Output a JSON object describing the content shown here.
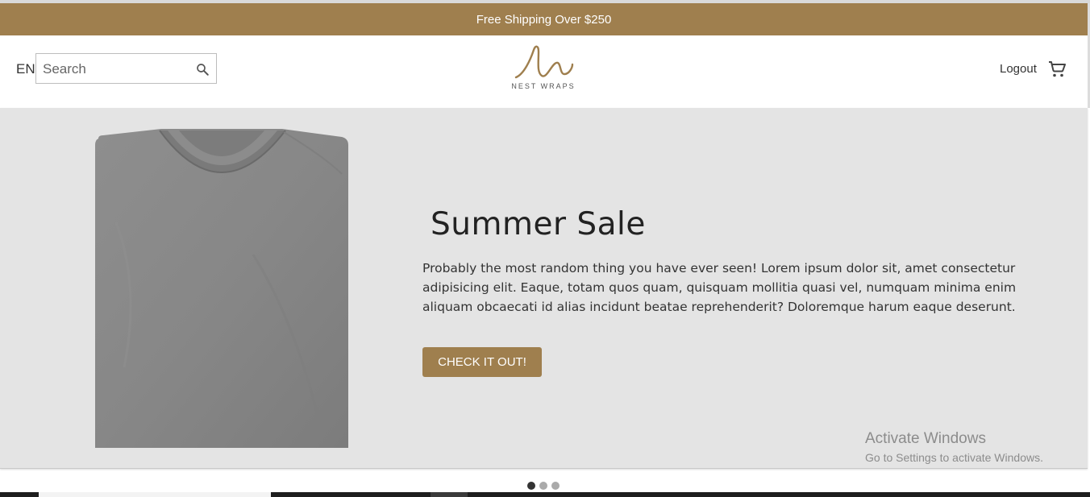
{
  "announcement": {
    "text": "Free Shipping Over $250"
  },
  "header": {
    "language": "EN",
    "search": {
      "placeholder": "Search",
      "value": ""
    },
    "logo": {
      "wordmark": "NEST WRAPS"
    },
    "logout_label": "Logout"
  },
  "hero": {
    "title": "Summer Sale",
    "description": "Probably the most random thing you have ever seen! Lorem ipsum dolor sit, amet consectetur adipisicing elit. Eaque, totam quos quam, quisquam mollitia quasi vel, numquam minima enim aliquam obcaecati id alias incidunt beatae reprehenderit? Doloremque harum eaque deserunt.",
    "cta_label": "CHECK IT OUT!"
  },
  "carousel": {
    "slide_count": 3,
    "active_index": 0
  },
  "watermark": {
    "line1": "Activate Windows",
    "line2": "Go to Settings to activate Windows."
  },
  "colors": {
    "brand": "#9f7f4e",
    "hero_bg": "#e4e4e4",
    "shirt": "#8a8a8a"
  },
  "icons": {
    "search": "search-icon",
    "cart": "cart-icon"
  }
}
